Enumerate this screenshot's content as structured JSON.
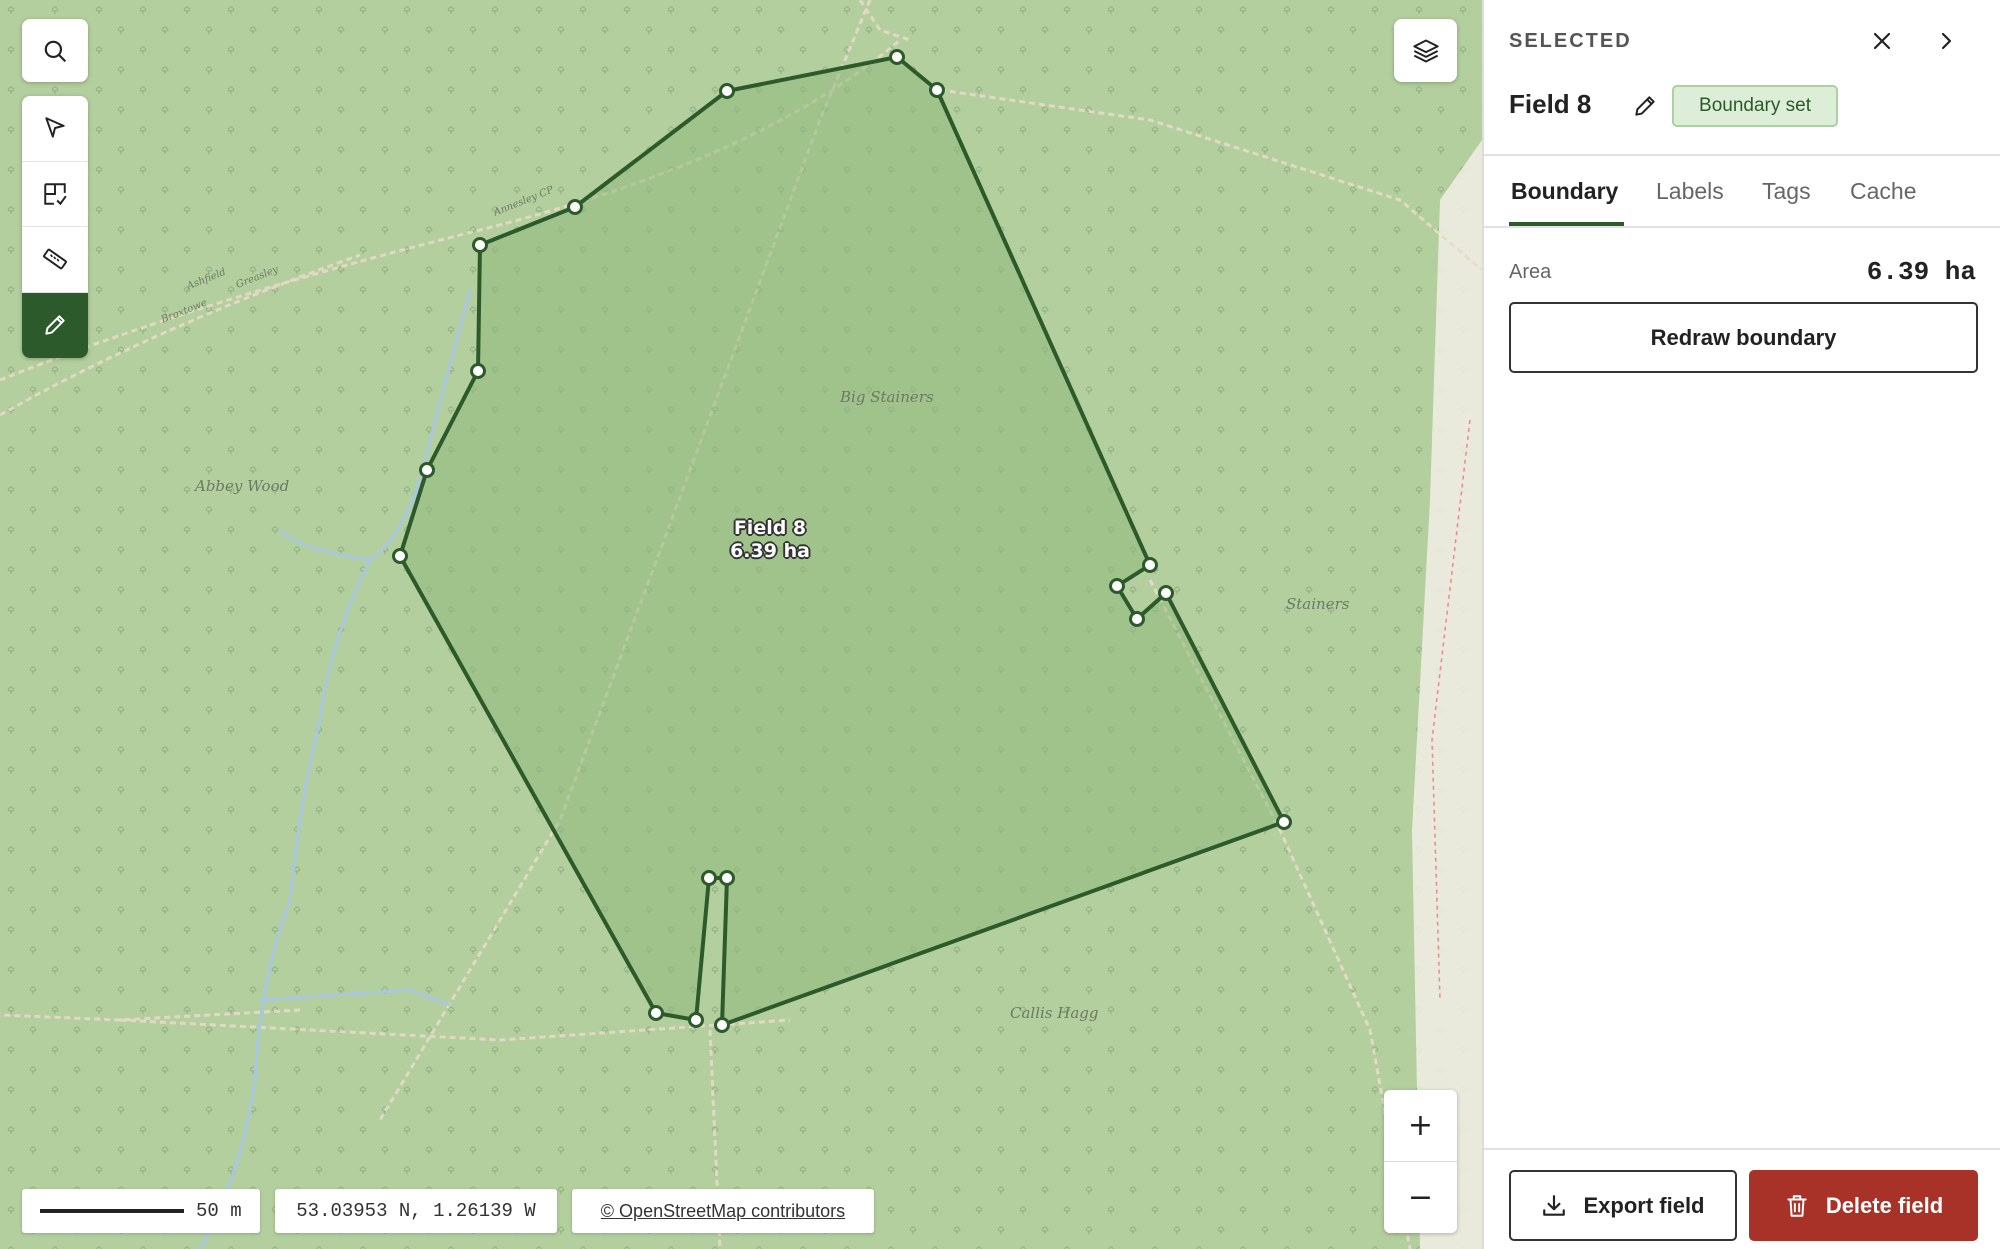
{
  "map": {
    "field_label_name": "Field 8",
    "field_label_area": "6.39 ha",
    "place_labels": {
      "big_stainers": "Big Stainers",
      "abbey_wood": "Abbey Wood",
      "stainers": "Stainers",
      "callis_hagg": "Callis Hagg",
      "annesley_cp": "Annesley CP",
      "ashfield": "Ashfield",
      "greasley": "Greasley",
      "broxtowe": "Broxtowe"
    },
    "colors": {
      "field_stroke": "#2d5a2a",
      "field_fill": "#8fba7d"
    }
  },
  "tools": {
    "search_icon": "search-icon",
    "select_icon": "cursor-arrow-icon",
    "fields_icon": "field-check-icon",
    "measure_icon": "ruler-icon",
    "draw_icon": "pencil-icon",
    "layers_icon": "layers-icon"
  },
  "zoom": {
    "in_label": "+",
    "out_label": "−"
  },
  "status": {
    "scale_label": "50 m",
    "coordinates": "53.03953 N, 1.26139 W",
    "attribution": "© OpenStreetMap contributors"
  },
  "panel": {
    "header": "SELECTED",
    "title": "Field 8",
    "badge": "Boundary set",
    "tabs": [
      "Boundary",
      "Labels",
      "Tags",
      "Cache"
    ],
    "active_tab": "Boundary",
    "area_label": "Area",
    "area_value": "6.39 ha",
    "redraw_label": "Redraw boundary",
    "export_label": "Export field",
    "delete_label": "Delete field",
    "colors": {
      "accent": "#2d5a2a",
      "badge_bg": "#ddeed8",
      "danger": "#a83228"
    }
  }
}
